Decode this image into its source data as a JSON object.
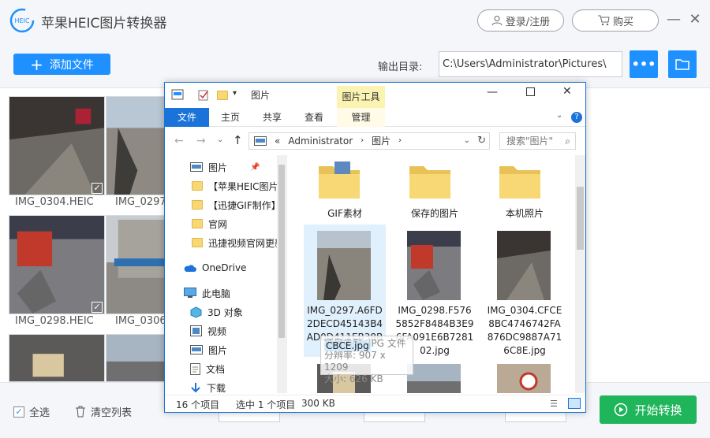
{
  "app": {
    "title": "苹果HEIC图片转换器",
    "logo_text": "HEIC",
    "login_label": "登录/注册",
    "buy_label": "购买",
    "add_file_label": "添加文件",
    "output_dir_label": "输出目录:",
    "output_dir_value": "C:\\Users\\Administrator\\Pictures\\",
    "more_label": "•••",
    "accent": "#1e90ff"
  },
  "thumbnails": [
    {
      "label": "IMG_0304.HEIC",
      "checked": true
    },
    {
      "label": "IMG_0297",
      "checked": false
    },
    {
      "label": "IMG_0298.HEIC",
      "checked": true
    },
    {
      "label": "IMG_0306",
      "checked": false
    }
  ],
  "footer": {
    "select_all_label": "全选",
    "clear_list_label": "清空列表",
    "start_label": "开始转换",
    "start_color": "#1fb55a"
  },
  "explorer": {
    "title": "图片",
    "picture_tools_label": "图片工具",
    "tabs": [
      "文件",
      "主页",
      "共享",
      "查看",
      "管理"
    ],
    "breadcrumb": [
      "Administrator",
      "图片"
    ],
    "breadcrumb_prefix": "«",
    "search_placeholder": "搜索\"图片\"",
    "nav": [
      {
        "label": "图片",
        "icon": "pictures-icon"
      },
      {
        "label": "【苹果HEIC图片",
        "icon": "folder-icon"
      },
      {
        "label": "【迅捷GIF制作】",
        "icon": "folder-icon"
      },
      {
        "label": "官网",
        "icon": "folder-icon"
      },
      {
        "label": "迅捷视频官网更新",
        "icon": "folder-icon"
      },
      {
        "label": "OneDrive",
        "icon": "cloud-icon"
      },
      {
        "label": "此电脑",
        "icon": "computer-icon"
      },
      {
        "label": "3D 对象",
        "icon": "cube-icon"
      },
      {
        "label": "视频",
        "icon": "video-icon"
      },
      {
        "label": "图片",
        "icon": "pictures-icon"
      },
      {
        "label": "文档",
        "icon": "document-icon"
      },
      {
        "label": "下载",
        "icon": "download-icon"
      }
    ],
    "folders": [
      "GIF素材",
      "保存的图片",
      "本机照片"
    ],
    "files": [
      {
        "name": "IMG_0297.A6FD2DECD45143B4AD0D411EB38BCBCE.jpg",
        "lines": [
          "IMG_0297.A6FD",
          "2DECD45143B4",
          "AD0D411EB38B",
          "CBCE.jpg"
        ]
      },
      {
        "name": "IMG_0298.F5765852F8484B3E96FA091E6B728102.jpg",
        "lines": [
          "IMG_0298.F576",
          "5852F8484B3E9",
          "6FA091E6B7281",
          "02.jpg"
        ]
      },
      {
        "name": "IMG_0304.CFCE8BC4746742FA876DC9887A716C8E.jpg",
        "lines": [
          "IMG_0304.CFCE",
          "8BC4746742FA",
          "876DC9887A71",
          "6C8E.jpg"
        ]
      }
    ],
    "tooltip": [
      "项目类型: JPG 文件",
      "分辨率: 907 x 1209",
      "大小: 626 KB"
    ],
    "status": {
      "count": "16 个项目",
      "selected": "选中 1 个项目",
      "size": "300 KB"
    }
  }
}
